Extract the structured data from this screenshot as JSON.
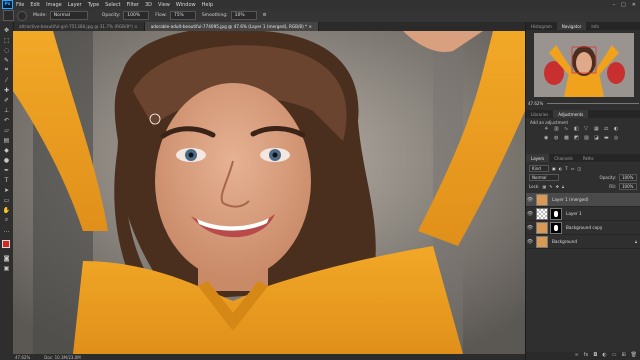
{
  "menu": {
    "logo": "Ps",
    "items": [
      "File",
      "Edit",
      "Image",
      "Layer",
      "Type",
      "Select",
      "Filter",
      "3D",
      "View",
      "Window",
      "Help"
    ],
    "window_buttons": [
      "–",
      "□",
      "✕"
    ]
  },
  "options_bar": {
    "mode_label": "Mode:",
    "mode_value": "Normal",
    "opacity_label": "Opacity:",
    "opacity_value": "100%",
    "flow_label": "Flow:",
    "flow_value": "75%",
    "smoothing_label": "Smoothing:",
    "smoothing_value": "10%"
  },
  "tabs": [
    {
      "label": "attractive-beautiful-girl-751368.jpg @ 31.7% (RGB/8*) ×",
      "active": false
    },
    {
      "label": "adorable-adult-beautiful-774095.jpg @ 47.6% (Layer 1 (merged), RGB/8) * ×",
      "active": true
    }
  ],
  "status": {
    "zoom": "47.62%",
    "doc": "Doc: 10.3M/23.0M"
  },
  "navigator": {
    "tabs": [
      "Histogram",
      "Navigator",
      "Info"
    ],
    "active": "Navigator",
    "zoom": "47.62%"
  },
  "adjustments": {
    "tabs": [
      "Libraries",
      "Adjustments"
    ],
    "active": "Adjustments",
    "hint": "Add an adjustment"
  },
  "layers": {
    "tabs": [
      "Layers",
      "Channels",
      "Paths"
    ],
    "active": "Layers",
    "kind_label": "Kind",
    "blend_mode": "Normal",
    "opacity_label": "Opacity:",
    "opacity_value": "100%",
    "lock_label": "Lock:",
    "fill_label": "Fill:",
    "fill_value": "100%",
    "items": [
      {
        "name": "Layer 1 (merged)",
        "selected": true,
        "mask": false
      },
      {
        "name": "Layer 1",
        "selected": false,
        "mask": true
      },
      {
        "name": "Background copy",
        "selected": false,
        "mask": true
      },
      {
        "name": "Background",
        "selected": false,
        "mask": false
      }
    ]
  },
  "colors": {
    "shirt": "#f0a21c",
    "foreground": "#d8261c",
    "panel": "#2f2f2f"
  }
}
